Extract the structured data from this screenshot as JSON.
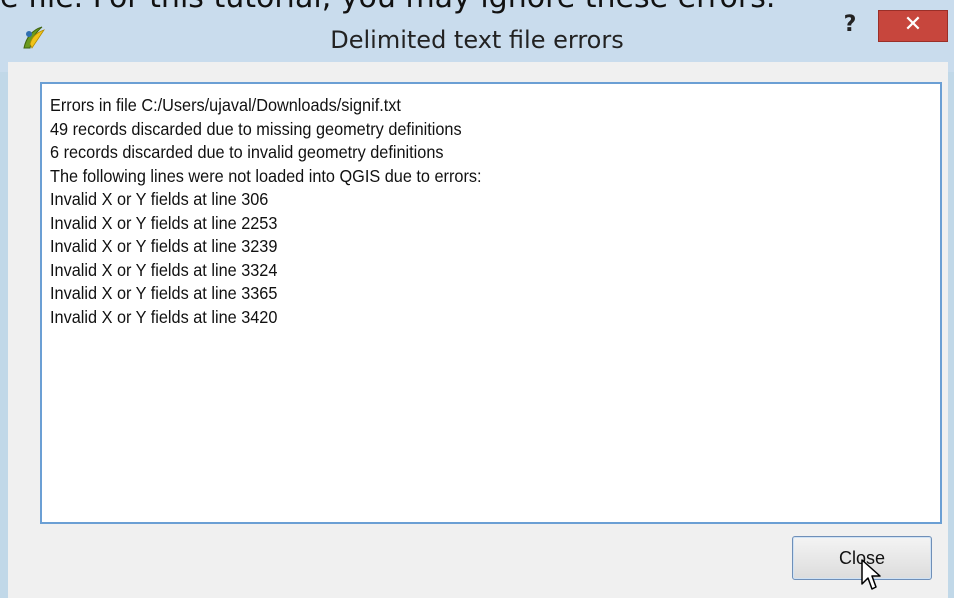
{
  "background_caption": "e file. For this tutorial, you may ignore these errors.",
  "dialog": {
    "title": "Delimited text file errors",
    "help_label": "?",
    "close_label": "✕",
    "lines": [
      "Errors in file C:/Users/ujaval/Downloads/signif.txt",
      "49 records discarded due to missing geometry definitions",
      "6 records discarded due to invalid geometry definitions",
      "The following lines were not loaded into QGIS due to errors:",
      "Invalid X or Y fields at line 306",
      "Invalid X or Y fields at line 2253",
      "Invalid X or Y fields at line 3239",
      "Invalid X or Y fields at line 3324",
      "Invalid X or Y fields at line 3365",
      "Invalid X or Y fields at line 3420"
    ],
    "button_close": "Close"
  },
  "colors": {
    "titlebar": "#c9dced",
    "close_button": "#c7463d",
    "textarea_border": "#6b9fd4"
  },
  "icons": {
    "app": "qgis-icon",
    "help": "help-icon",
    "close": "close-icon",
    "cursor": "mouse-pointer-icon"
  }
}
